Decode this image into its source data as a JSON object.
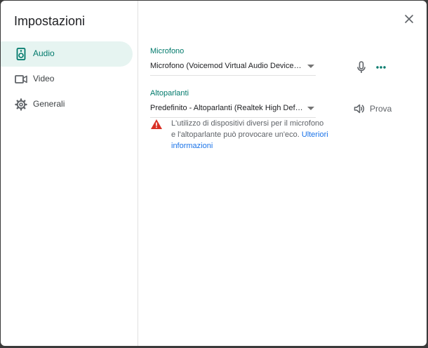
{
  "dialog": {
    "title": "Impostazioni",
    "close_icon": "close-icon"
  },
  "sidebar": {
    "items": [
      {
        "label": "Audio",
        "icon": "speaker-icon",
        "active": true
      },
      {
        "label": "Video",
        "icon": "videocam-icon",
        "active": false
      },
      {
        "label": "Generali",
        "icon": "gear-icon",
        "active": false
      }
    ]
  },
  "audio": {
    "microphone": {
      "label": "Microfono",
      "selected": "Microfono (Voicemod Virtual Audio Device (WDM))",
      "icons": [
        "mic-icon",
        "more-icon"
      ]
    },
    "speakers": {
      "label": "Altoparlanti",
      "selected": "Predefinito - Altoparlanti (Realtek High Definition Audio)",
      "test_label": "Prova",
      "test_icon": "volume-icon"
    },
    "warning": {
      "icon": "warning-icon",
      "text": "L'utilizzo di dispositivi diversi per il microfono e l'altoparlante può provocare un'eco.",
      "link": "Ulteriori informazioni"
    }
  },
  "colors": {
    "accent": "#00796b",
    "active_bg": "#e6f4f1",
    "warning": "#d93025",
    "link": "#1a73e8"
  }
}
